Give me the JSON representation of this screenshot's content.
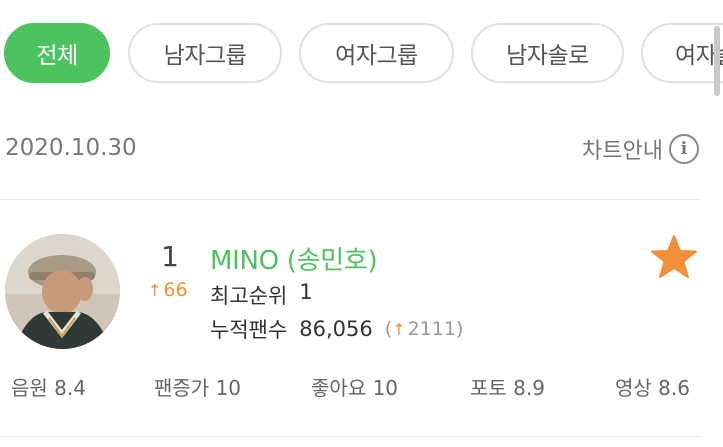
{
  "filters": [
    {
      "label": "전체",
      "active": true
    },
    {
      "label": "남자그룹",
      "active": false
    },
    {
      "label": "여자그룹",
      "active": false
    },
    {
      "label": "남자솔로",
      "active": false
    },
    {
      "label": "여자솔",
      "active": false
    }
  ],
  "chart_header": {
    "date": "2020.10.30",
    "guide_label": "차트안내",
    "info_icon": "info-circle-icon"
  },
  "entry": {
    "rank": "1",
    "rank_change_arrow": "↑",
    "rank_change": "66",
    "name": "MINO (송민호)",
    "best_rank_label": "최고순위",
    "best_rank": "1",
    "fans_label": "누적팬수",
    "fans": "86,056",
    "fans_change_open": "(",
    "fans_change_arrow": "↑",
    "fans_change": "2111",
    "fans_change_close": ")",
    "favorite_icon": "star-icon",
    "favorite_color": "#f0913a"
  },
  "metrics": [
    {
      "label": "음원",
      "value": "8.4"
    },
    {
      "label": "팬증가",
      "value": "10"
    },
    {
      "label": "좋아요",
      "value": "10"
    },
    {
      "label": "포토",
      "value": "8.9"
    },
    {
      "label": "영상",
      "value": "8.6"
    }
  ],
  "colors": {
    "accent": "#4cc35e",
    "up": "#f0913a"
  }
}
